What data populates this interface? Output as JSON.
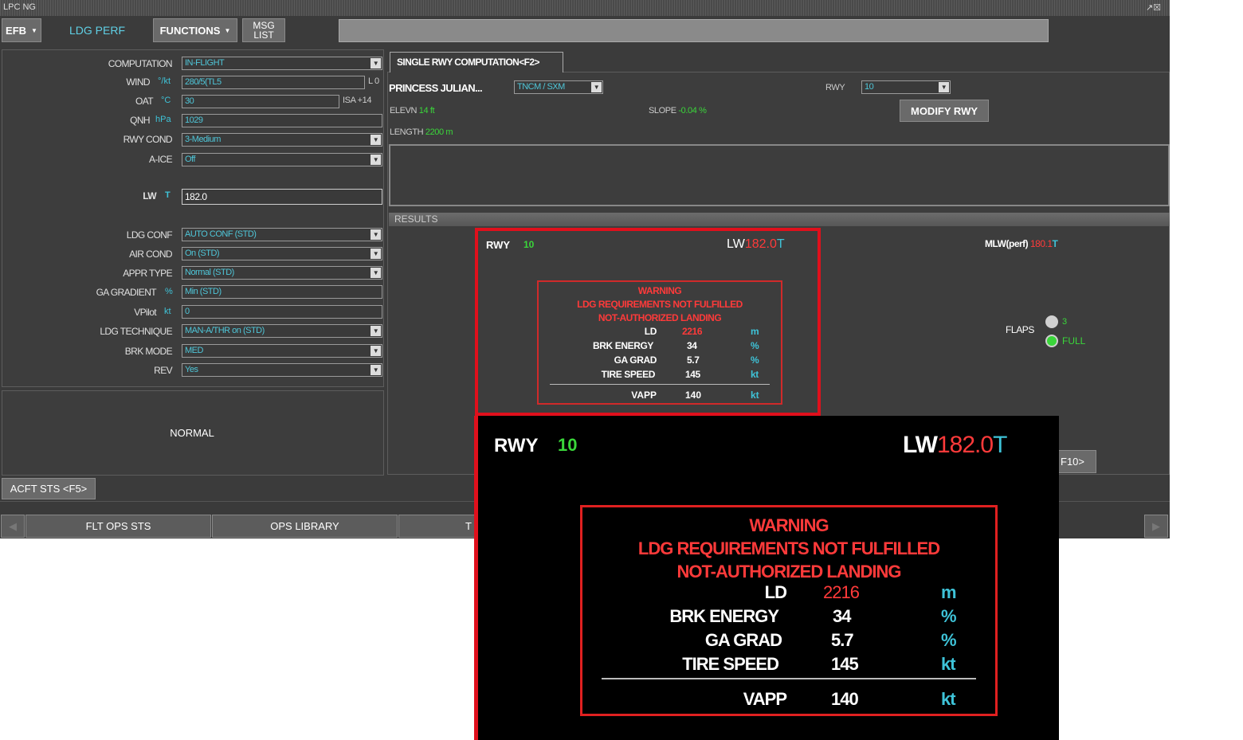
{
  "window": {
    "title": "LPC NG",
    "controls": "↗☒"
  },
  "toolbar": {
    "efb": "EFB",
    "ldg_perf": "LDG PERF",
    "functions": "FUNCTIONS",
    "msg_line1": "MSG",
    "msg_line2": "LIST"
  },
  "form": {
    "computation": {
      "label": "COMPUTATION",
      "value": "IN-FLIGHT"
    },
    "wind": {
      "label": "WIND",
      "unit": "°/kt",
      "value": "280/5(TL5",
      "suffix": "L 0"
    },
    "oat": {
      "label": "OAT",
      "unit": "°C",
      "value": "30",
      "suffix": "ISA +14"
    },
    "qnh": {
      "label": "QNH",
      "unit": "hPa",
      "value": "1029"
    },
    "rwy_cond": {
      "label": "RWY COND",
      "value": "3-Medium"
    },
    "aice": {
      "label": "A-ICE",
      "value": "Off"
    },
    "lw": {
      "label": "LW",
      "unit": "T",
      "value": "182.0"
    },
    "ldg_conf": {
      "label": "LDG CONF",
      "value": "AUTO CONF (STD)"
    },
    "air_cond": {
      "label": "AIR COND",
      "value": "On (STD)"
    },
    "appr_type": {
      "label": "APPR TYPE",
      "value": "Normal (STD)"
    },
    "ga_gradient": {
      "label": "GA GRADIENT",
      "unit": "%",
      "value": "Min (STD)"
    },
    "vpilot": {
      "label": "VPilot",
      "unit": "kt",
      "value": "0"
    },
    "ldg_technique": {
      "label": "LDG TECHNIQUE",
      "value": "MAN-A/THR on (STD)"
    },
    "brk_mode": {
      "label": "BRK MODE",
      "value": "MED"
    },
    "rev": {
      "label": "REV",
      "value": "Yes"
    }
  },
  "status": "NORMAL",
  "acft_sts_button": "ACFT STS <F5>",
  "runway": {
    "tab": "SINGLE RWY COMPUTATION<F2>",
    "airport": "PRINCESS JULIAN...",
    "airport_code": "TNCM / SXM",
    "rwy_label": "RWY",
    "rwy_value": "10",
    "elevn_label": "ELEVN",
    "elevn_value": "14 ft",
    "slope_label": "SLOPE",
    "slope_value": "-0.04 %",
    "length_label": "LENGTH",
    "length_value": "2200 m",
    "modify_button": "MODIFY RWY"
  },
  "results": {
    "header": "RESULTS",
    "rwy_label": "RWY",
    "rwy_value": "10",
    "lw_label": "LW",
    "lw_value": "182.0",
    "lw_unit": "T",
    "mlw_label": "MLW(perf)",
    "mlw_value": "180.1",
    "mlw_unit": "T",
    "flaps_label": "FLAPS",
    "flaps_options": [
      "3",
      "FULL"
    ],
    "warning_lines": [
      "WARNING",
      "LDG REQUIREMENTS NOT FULFILLED",
      "NOT-AUTHORIZED LANDING"
    ],
    "rows": [
      {
        "key": "LD",
        "value": "2216",
        "unit": "m"
      },
      {
        "key": "BRK ENERGY",
        "value": "34",
        "unit": "%"
      },
      {
        "key": "GA GRAD",
        "value": "5.7",
        "unit": "%"
      },
      {
        "key": "TIRE SPEED",
        "value": "145",
        "unit": "kt"
      }
    ],
    "vapp": {
      "key": "VAPP",
      "value": "140",
      "unit": "kt"
    },
    "f10_button": "F10>"
  },
  "bottom_nav": {
    "prev": "◀",
    "flt_ops_sts": "FLT OPS STS",
    "ops_library": "OPS LIBRARY",
    "third_partial": "T",
    "next": "▶"
  },
  "colors": {
    "window_bg": "#3b3b3b",
    "accent_cyan": "#3ec3d8",
    "warning_red": "#ff3a3a",
    "ok_green": "#3ad63a",
    "highlight_frame": "#e0101c"
  }
}
